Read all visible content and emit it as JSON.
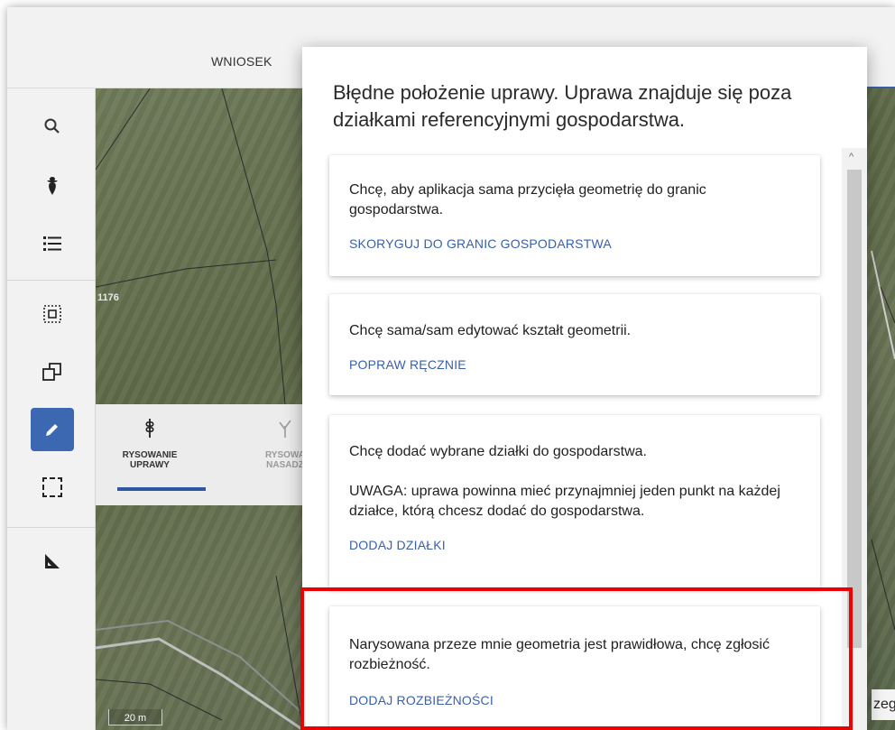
{
  "header": {
    "tab_label": "WNIOSEK"
  },
  "map": {
    "parcel_label": "1176",
    "scale_label": "20 m"
  },
  "sidebar": {
    "icons": [
      "search-icon",
      "crop-icon",
      "list-icon",
      "select-area-icon",
      "copy-geometry-icon",
      "pencil-icon",
      "selection-box-icon",
      "measure-icon"
    ]
  },
  "draw_toolbar": {
    "items": [
      {
        "line1": "RYSOWANIE",
        "line2": "UPRAWY"
      },
      {
        "line1": "RYSOWA",
        "line2": "NASADZ"
      }
    ]
  },
  "behind_text": "zeg",
  "dialog": {
    "title": "Błędne położenie uprawy. Uprawa znajduje się poza działkami referencyjnymi gospodarstwa.",
    "cards": [
      {
        "text": "Chcę, aby aplikacja sama przycięła geometrię do granic gospodarstwa.",
        "action": "SKORYGUJ DO GRANIC GOSPODARSTWA"
      },
      {
        "text": "Chcę sama/sam edytować kształt geometrii.",
        "action": "POPRAW RĘCZNIE"
      },
      {
        "text": "Chcę dodać wybrane działki do gospodarstwa.",
        "note": "UWAGA: uprawa powinna mieć przynajmniej jeden punkt na każdej działce, którą chcesz dodać do gospodarstwa.",
        "action": "DODAJ DZIAŁKI"
      },
      {
        "text": "Narysowana przeze mnie geometria jest prawidłowa, chcę zgłosić rozbieżność.",
        "action": "DODAJ ROZBIEŻNOŚCI"
      }
    ]
  },
  "colors": {
    "accent": "#3a5fa8",
    "highlight": "#ef0000",
    "sidebar_active": "#3c68b1"
  }
}
